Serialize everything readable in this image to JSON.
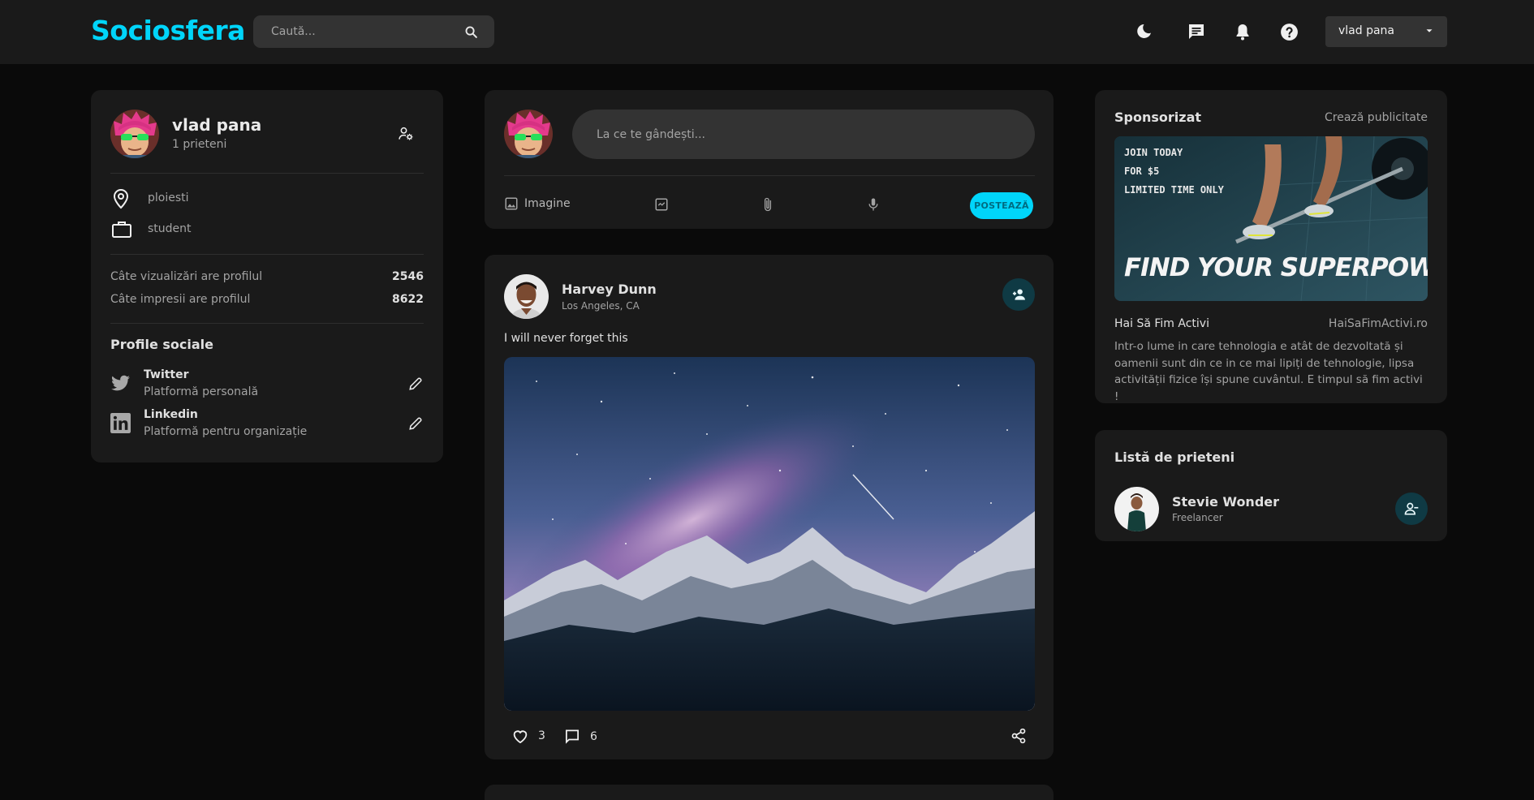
{
  "brand": {
    "logo": "Sociosfera",
    "accent": "#00d5fa"
  },
  "nav": {
    "search_placeholder": "Caută...",
    "icons": [
      "dark-mode-icon",
      "message-icon",
      "notifications-icon",
      "help-icon"
    ],
    "user_name": "vlad pana"
  },
  "profile": {
    "name": "vlad pana",
    "friends_count": "1 prieteni",
    "location": "ploiesti",
    "occupation": "student",
    "stats": [
      {
        "label": "Câte vizualizări are profilul",
        "value": "2546"
      },
      {
        "label": "Câte impresii are profilul",
        "value": "8622"
      }
    ],
    "social_title": "Profile sociale",
    "socials": [
      {
        "name": "Twitter",
        "desc": "Platformă personală"
      },
      {
        "name": "Linkedin",
        "desc": "Platformă pentru organizație"
      }
    ]
  },
  "composer": {
    "placeholder": "La ce te gândești...",
    "image_label": "Imagine",
    "post_label": "POSTEAZĂ"
  },
  "post": {
    "author": "Harvey Dunn",
    "location": "Los Angeles, CA",
    "text": "I will never forget this",
    "likes": "3",
    "comments": "6"
  },
  "ad": {
    "title": "Sponsorizat",
    "create_link": "Crează publicitate",
    "banner_lines": [
      "JOIN TODAY",
      "FOR $5",
      "LIMITED TIME ONLY"
    ],
    "banner_headline": "FIND YOUR SUPERPOWER",
    "brand": "Hai Să Fim Activi",
    "website": "HaiSaFimActivi.ro",
    "description": "Intr-o lume in care tehnologia e atât de dezvoltată și oamenii sunt din ce in ce mai lipiți de tehnologie, lipsa activității fizice își spune cuvântul. E timpul să fim activi !"
  },
  "friends": {
    "title": "Listă de prieteni",
    "list": [
      {
        "name": "Stevie Wonder",
        "role": "Freelancer"
      }
    ]
  }
}
